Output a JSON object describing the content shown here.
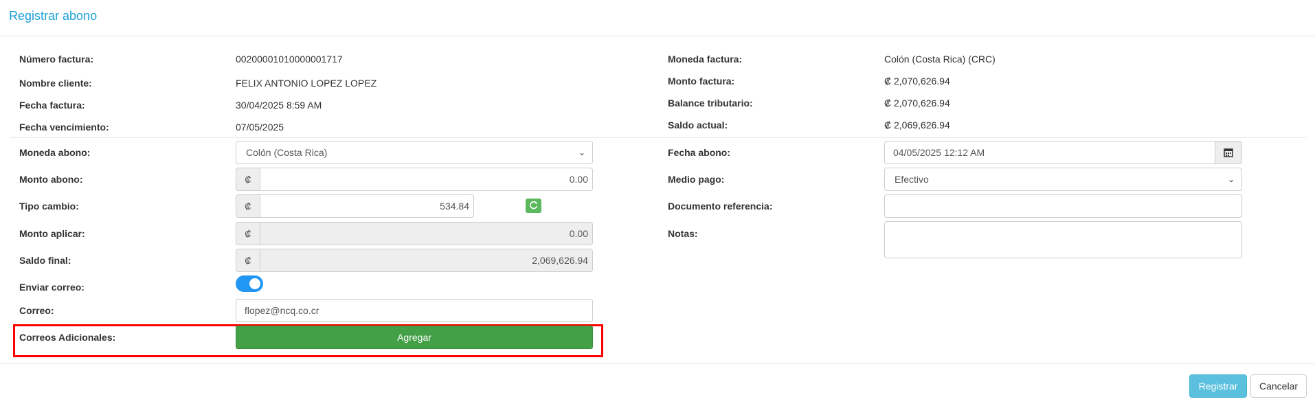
{
  "dialog": {
    "title": "Registrar abono"
  },
  "invoice": {
    "numero_label": "Número factura:",
    "numero_value": "00200001010000001717",
    "cliente_label": "Nombre cliente:",
    "cliente_value": "FELIX ANTONIO LOPEZ LOPEZ",
    "fecha_label": "Fecha factura:",
    "fecha_value": "30/04/2025 8:59 AM",
    "vencimiento_label": "Fecha vencimiento:",
    "vencimiento_value": "07/05/2025",
    "moneda_label": "Moneda factura:",
    "moneda_value": "Colón (Costa Rica) (CRC)",
    "monto_label": "Monto factura:",
    "monto_value": "₡ 2,070,626.94",
    "balance_label": "Balance tributario:",
    "balance_value": "₡ 2,070,626.94",
    "saldo_label": "Saldo actual:",
    "saldo_value": "₡ 2,069,626.94"
  },
  "form": {
    "moneda_abono_label": "Moneda abono:",
    "moneda_abono_value": "Colón (Costa Rica)",
    "monto_abono_label": "Monto abono:",
    "monto_abono_value": "0.00",
    "tipo_cambio_label": "Tipo cambio:",
    "tipo_cambio_value": "534.84",
    "monto_aplicar_label": "Monto aplicar:",
    "monto_aplicar_value": "0.00",
    "saldo_final_label": "Saldo final:",
    "saldo_final_value": "2,069,626.94",
    "enviar_correo_label": "Enviar correo:",
    "enviar_correo_on": true,
    "correo_label": "Correo:",
    "correo_value": "flopez@ncq.co.cr",
    "correos_adicionales_label": "Correos Adicionales:",
    "agregar_label": "Agregar",
    "currency_symbol": "₡",
    "fecha_abono_label": "Fecha abono:",
    "fecha_abono_value": "04/05/2025 12:12 AM",
    "medio_pago_label": "Medio pago:",
    "medio_pago_value": "Efectivo",
    "documento_label": "Documento referencia:",
    "documento_value": "",
    "notas_label": "Notas:",
    "notas_value": ""
  },
  "footer": {
    "registrar_label": "Registrar",
    "cancelar_label": "Cancelar"
  },
  "colors": {
    "title": "#1ba0d8",
    "toggle": "#2196f3",
    "agregar": "#43a047",
    "registrar": "#5bc0de",
    "highlight": "#ff0000"
  },
  "icons": {
    "calendar": "calendar-icon",
    "refresh": "refresh-icon",
    "chevron": "chevron-down-icon"
  }
}
